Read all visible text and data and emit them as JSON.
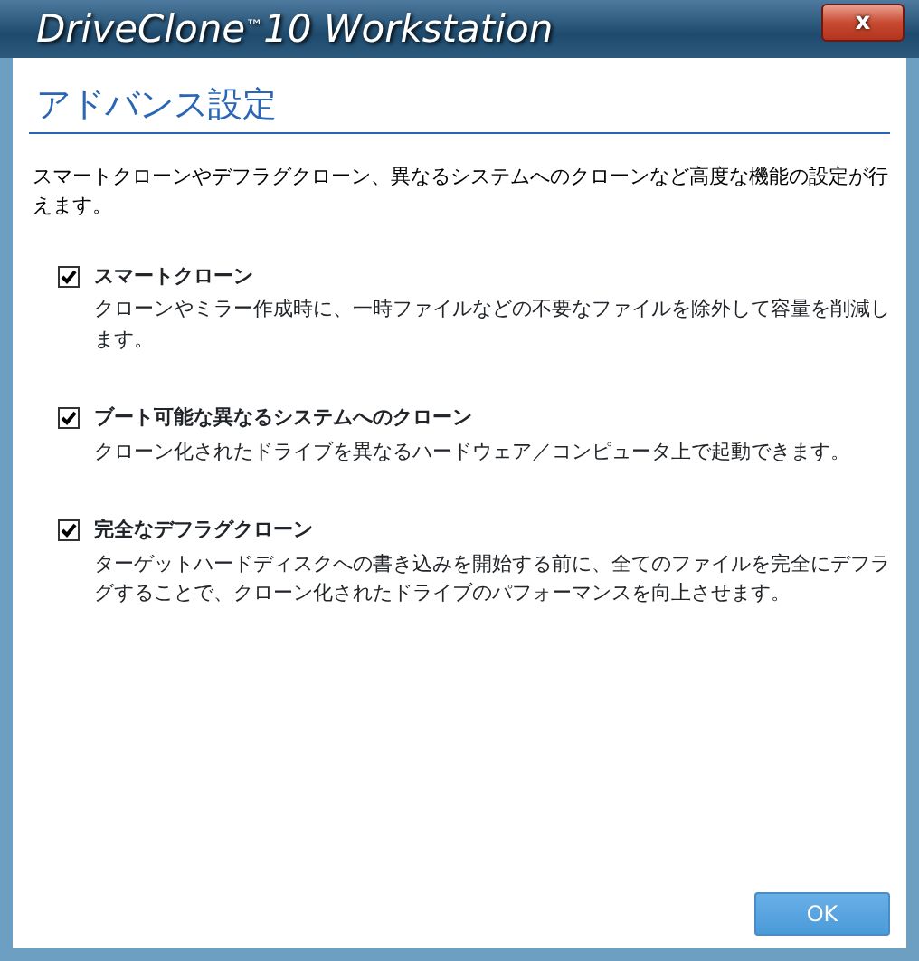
{
  "window": {
    "title": "DriveClone$^{™}$10 Workstation",
    "close": "x"
  },
  "heading": "アドバンス設定",
  "description": "スマートクローンやデフラグクローン、異なるシステムへのクローンなど高度な機能の設定が行えます。",
  "options": [
    {
      "label": "スマートクローン",
      "checked": true,
      "description": "クローンやミラー作成時に、一時ファイルなどの不要なファイルを除外して容量を削減します。"
    },
    {
      "label": "ブート可能な異なるシステムへのクローン",
      "checked": true,
      "description": "クローン化されたドライブを異なるハードウェア／コンピュータ上で起動できます。"
    },
    {
      "label": "完全なデフラグクローン",
      "checked": true,
      "description": "ターゲットハードディスクへの書き込みを開始する前に、全てのファイルを完全にデフラグすることで、クローン化されたドライブのパフォーマンスを向上させます。"
    }
  ],
  "buttons": [
    "OK"
  ]
}
